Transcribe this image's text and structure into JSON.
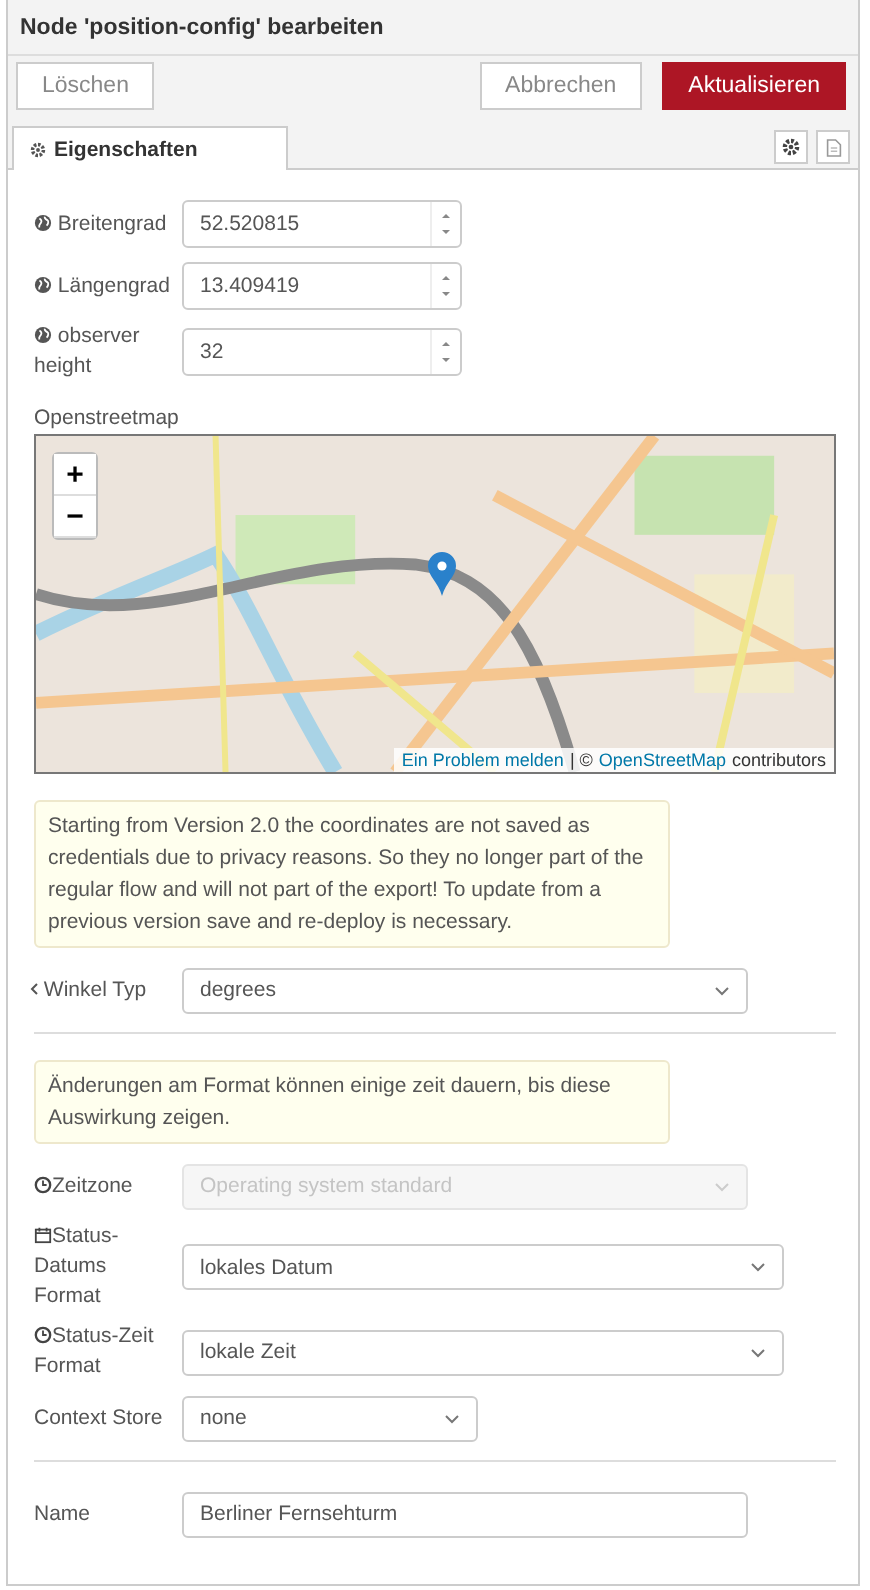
{
  "dialog": {
    "title": "Node 'position-config' bearbeiten"
  },
  "toolbar": {
    "delete": "Löschen",
    "cancel": "Abbrechen",
    "update": "Aktualisieren"
  },
  "tabs": [
    {
      "label": "Eigenschaften",
      "selected": true
    }
  ],
  "position_fields": [
    {
      "label": "Breitengrad",
      "value": "52.520815"
    },
    {
      "label": "Längengrad",
      "value": "13.409419"
    },
    {
      "label": "observer height",
      "value": "32"
    }
  ],
  "map": {
    "label": "Openstreetmap",
    "zoom_in": "+",
    "zoom_out": "−",
    "report_link": "Ein Problem melden",
    "separator": "| ©",
    "osm_link": "OpenStreetMap",
    "contributors": "contributors"
  },
  "credentials_note": "Starting from Version 2.0 the coordinates are not saved as credentials due to privacy reasons. So they no longer part of the regular flow and will not part of the export! To update from a previous version save and re-deploy is necessary.",
  "angle_type": {
    "label": "Winkel Typ",
    "value": "degrees"
  },
  "format_note": "Änderungen am Format können einige zeit dauern, bis diese Auswirkung zeigen.",
  "format_fields": [
    {
      "label": "Zeitzone",
      "value": "Operating system standard",
      "disabled": true
    },
    {
      "label": "Status-Datums Format",
      "value": "lokales Datum",
      "disabled": false
    },
    {
      "label": "Status-Zeit Format",
      "value": "lokale Zeit",
      "disabled": false
    },
    {
      "label": "Context Store",
      "value": "none",
      "disabled": false
    }
  ],
  "name_field": {
    "label": "Name",
    "value": "Berliner Fernsehturm"
  }
}
